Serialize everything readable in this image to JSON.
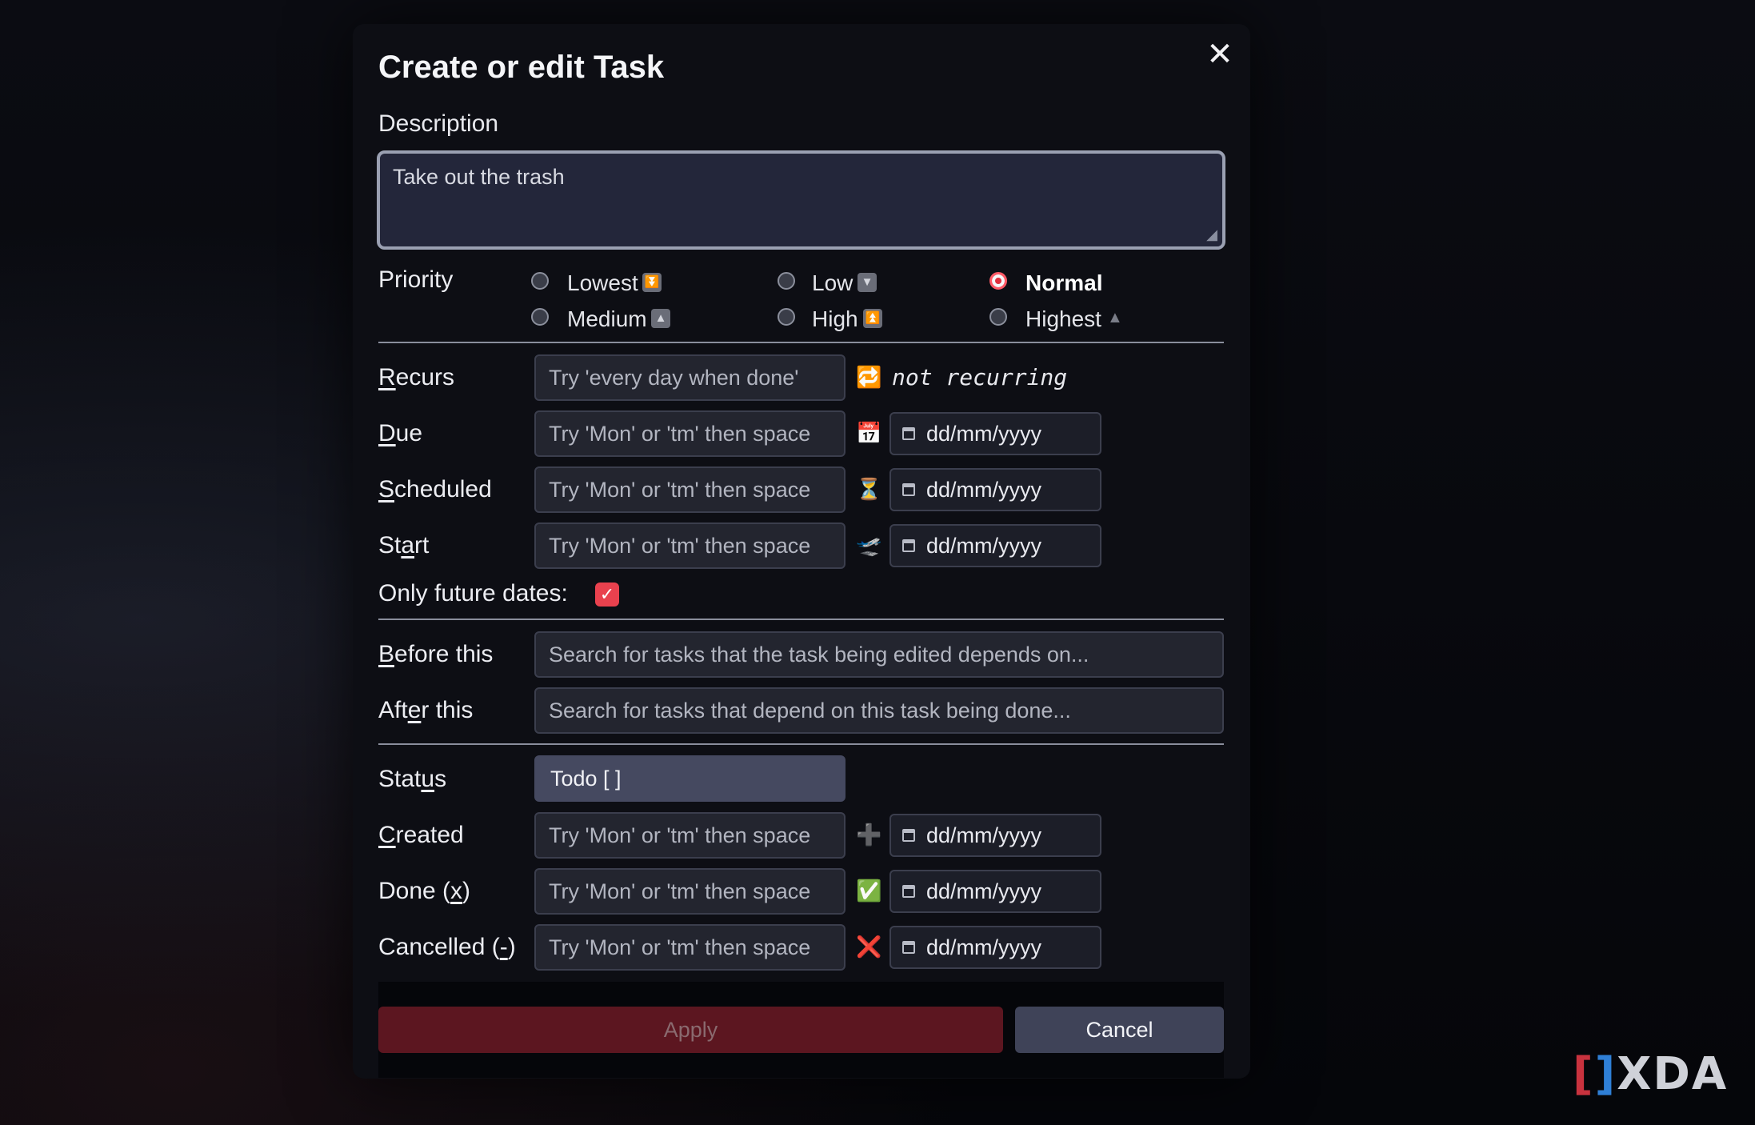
{
  "dialog": {
    "title": "Create or edit Task",
    "close_icon": "close-icon",
    "close_glyph": "✕"
  },
  "description": {
    "label": "Description",
    "value": "Take out the trash"
  },
  "priority": {
    "label": "Priority",
    "selected": "Normal",
    "options": [
      {
        "label": "Lowest",
        "icon": "double-down-arrow-icon",
        "glyph": "⏬"
      },
      {
        "label": "Low",
        "icon": "down-triangle-icon",
        "glyph": "▼"
      },
      {
        "label": "Normal",
        "icon": "",
        "glyph": ""
      },
      {
        "label": "Medium",
        "icon": "up-triangle-icon",
        "glyph": "▲"
      },
      {
        "label": "High",
        "icon": "double-up-arrow-icon",
        "glyph": "⏫"
      },
      {
        "label": "Highest",
        "icon": "small-up-triangle-icon",
        "glyph": "▲"
      }
    ]
  },
  "recurs": {
    "label": "Recurs",
    "placeholder": "Try 'every day when done'",
    "icon": "repeat-icon",
    "glyph": "🔁",
    "status": "not recurring"
  },
  "dates": [
    {
      "label": "Due",
      "placeholder": "Try 'Mon' or 'tm' then space",
      "icon": "calendar-icon",
      "glyph": "📅",
      "date_placeholder": "dd/mm/yyyy"
    },
    {
      "label": "Scheduled",
      "placeholder": "Try 'Mon' or 'tm' then space",
      "icon": "hourglass-icon",
      "glyph": "⏳",
      "date_placeholder": "dd/mm/yyyy"
    },
    {
      "label": "Start",
      "placeholder": "Try 'Mon' or 'tm' then space",
      "icon": "airplane-departure-icon",
      "glyph": "🛫",
      "date_placeholder": "dd/mm/yyyy"
    }
  ],
  "only_future_dates": {
    "label": "Only future dates:",
    "checked": true
  },
  "dependencies": {
    "before": {
      "label": "Before this",
      "placeholder": "Search for tasks that the task being edited depends on..."
    },
    "after": {
      "label": "After this",
      "placeholder": "Search for tasks that depend on this task being done..."
    }
  },
  "status": {
    "label": "Status",
    "value": "Todo [ ]"
  },
  "meta_dates": [
    {
      "label": "Created",
      "placeholder": "Try 'Mon' or 'tm' then space",
      "icon": "plus-icon",
      "glyph": "➕",
      "date_placeholder": "dd/mm/yyyy"
    },
    {
      "label": "Done (x)",
      "placeholder": "Try 'Mon' or 'tm' then space",
      "icon": "check-mark-icon",
      "glyph": "✅",
      "date_placeholder": "dd/mm/yyyy"
    },
    {
      "label": "Cancelled (-)",
      "placeholder": "Try 'Mon' or 'tm' then space",
      "icon": "cross-mark-icon",
      "glyph": "❌",
      "date_placeholder": "dd/mm/yyyy"
    }
  ],
  "buttons": {
    "apply": "Apply",
    "cancel": "Cancel"
  },
  "watermark": {
    "text": "XDA"
  },
  "colors": {
    "accent": "#e02f3d",
    "apply_disabled": "#5c1620",
    "cancel_bg": "#3f4358",
    "background": "#0d0e14"
  }
}
